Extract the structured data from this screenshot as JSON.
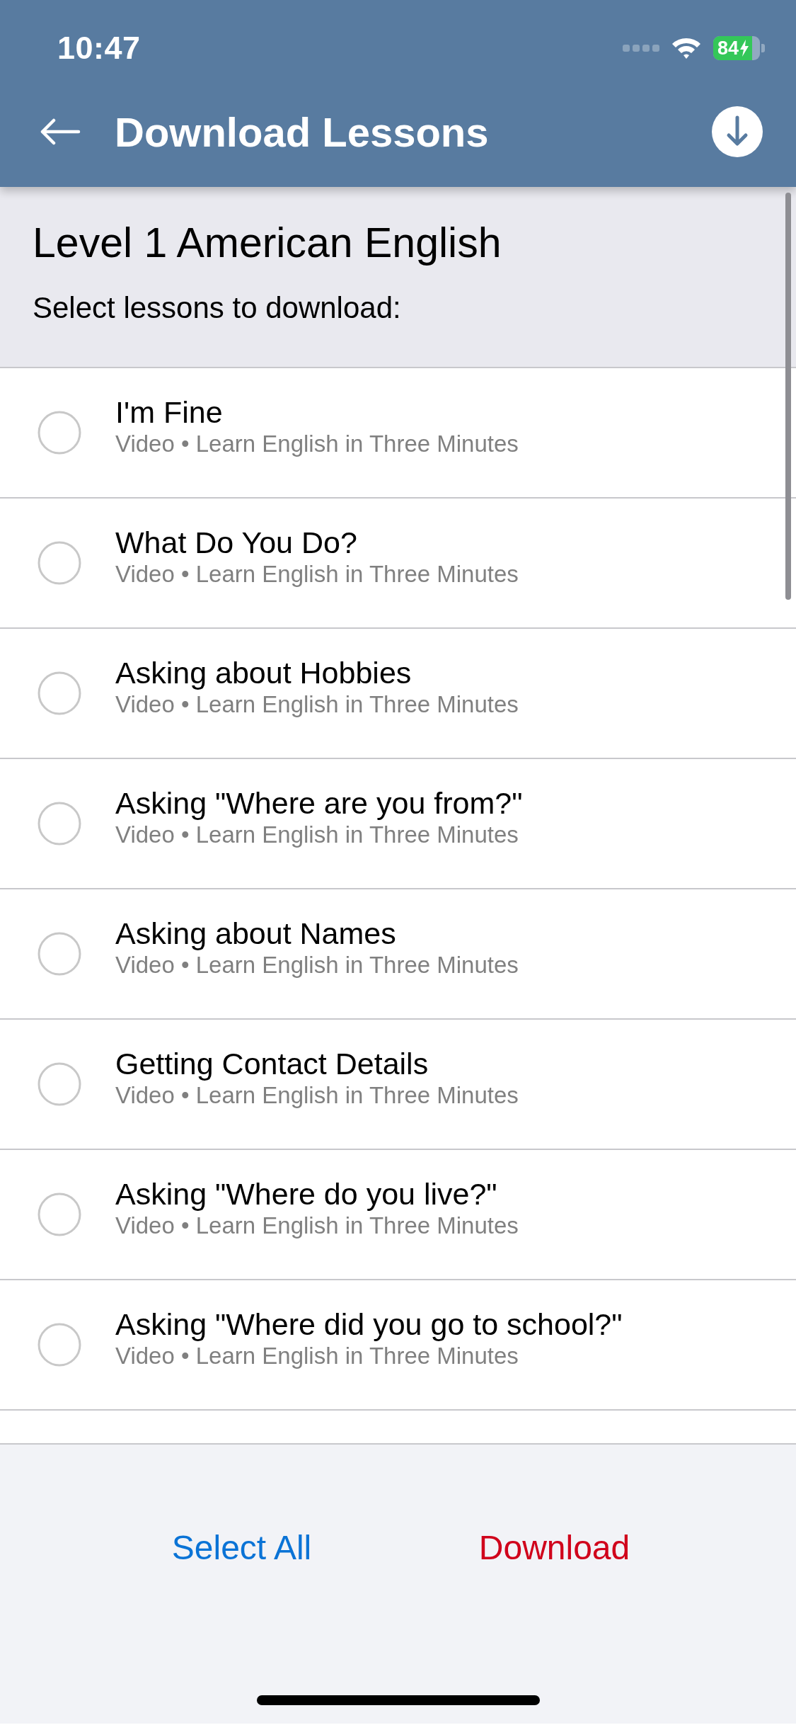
{
  "status_bar": {
    "time": "10:47",
    "battery_percent": "84"
  },
  "header": {
    "title": "Download Lessons"
  },
  "section": {
    "title": "Level 1 American English",
    "subtitle": "Select lessons to download:"
  },
  "lessons": [
    {
      "title": "I'm Fine",
      "subtitle": "Video • Learn English in Three Minutes",
      "selected": false
    },
    {
      "title": "What Do You Do?",
      "subtitle": "Video • Learn English in Three Minutes",
      "selected": false
    },
    {
      "title": "Asking about Hobbies",
      "subtitle": "Video • Learn English in Three Minutes",
      "selected": false
    },
    {
      "title": "Asking \"Where are you from?\"",
      "subtitle": "Video • Learn English in Three Minutes",
      "selected": false
    },
    {
      "title": "Asking about Names",
      "subtitle": "Video • Learn English in Three Minutes",
      "selected": false
    },
    {
      "title": "Getting Contact Details",
      "subtitle": "Video • Learn English in Three Minutes",
      "selected": false
    },
    {
      "title": "Asking \"Where do you live?\"",
      "subtitle": "Video • Learn English in Three Minutes",
      "selected": false
    },
    {
      "title": "Asking \"Where did you go to school?\"",
      "subtitle": "Video • Learn English in Three Minutes",
      "selected": false
    }
  ],
  "actions": [
    {
      "label": "Select All",
      "color": "#0a73d6"
    },
    {
      "label": "Download",
      "color": "#d0021b"
    }
  ]
}
